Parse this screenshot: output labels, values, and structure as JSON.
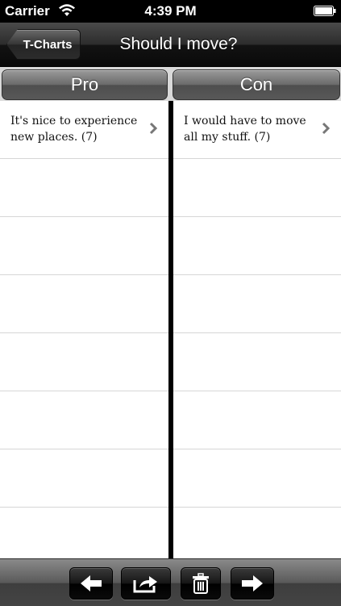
{
  "status_bar": {
    "carrier": "Carrier",
    "time": "4:39 PM"
  },
  "nav": {
    "back_label": "T-Charts",
    "title": "Should I move?"
  },
  "columns": {
    "pro": {
      "label": "Pro",
      "items": [
        "It's nice to experience new places. (7)"
      ]
    },
    "con": {
      "label": "Con",
      "items": [
        "I would have to move all my stuff. (7)"
      ]
    }
  },
  "toolbar": {
    "icons": [
      "arrow-left-icon",
      "share-icon",
      "trash-icon",
      "arrow-right-icon"
    ]
  }
}
